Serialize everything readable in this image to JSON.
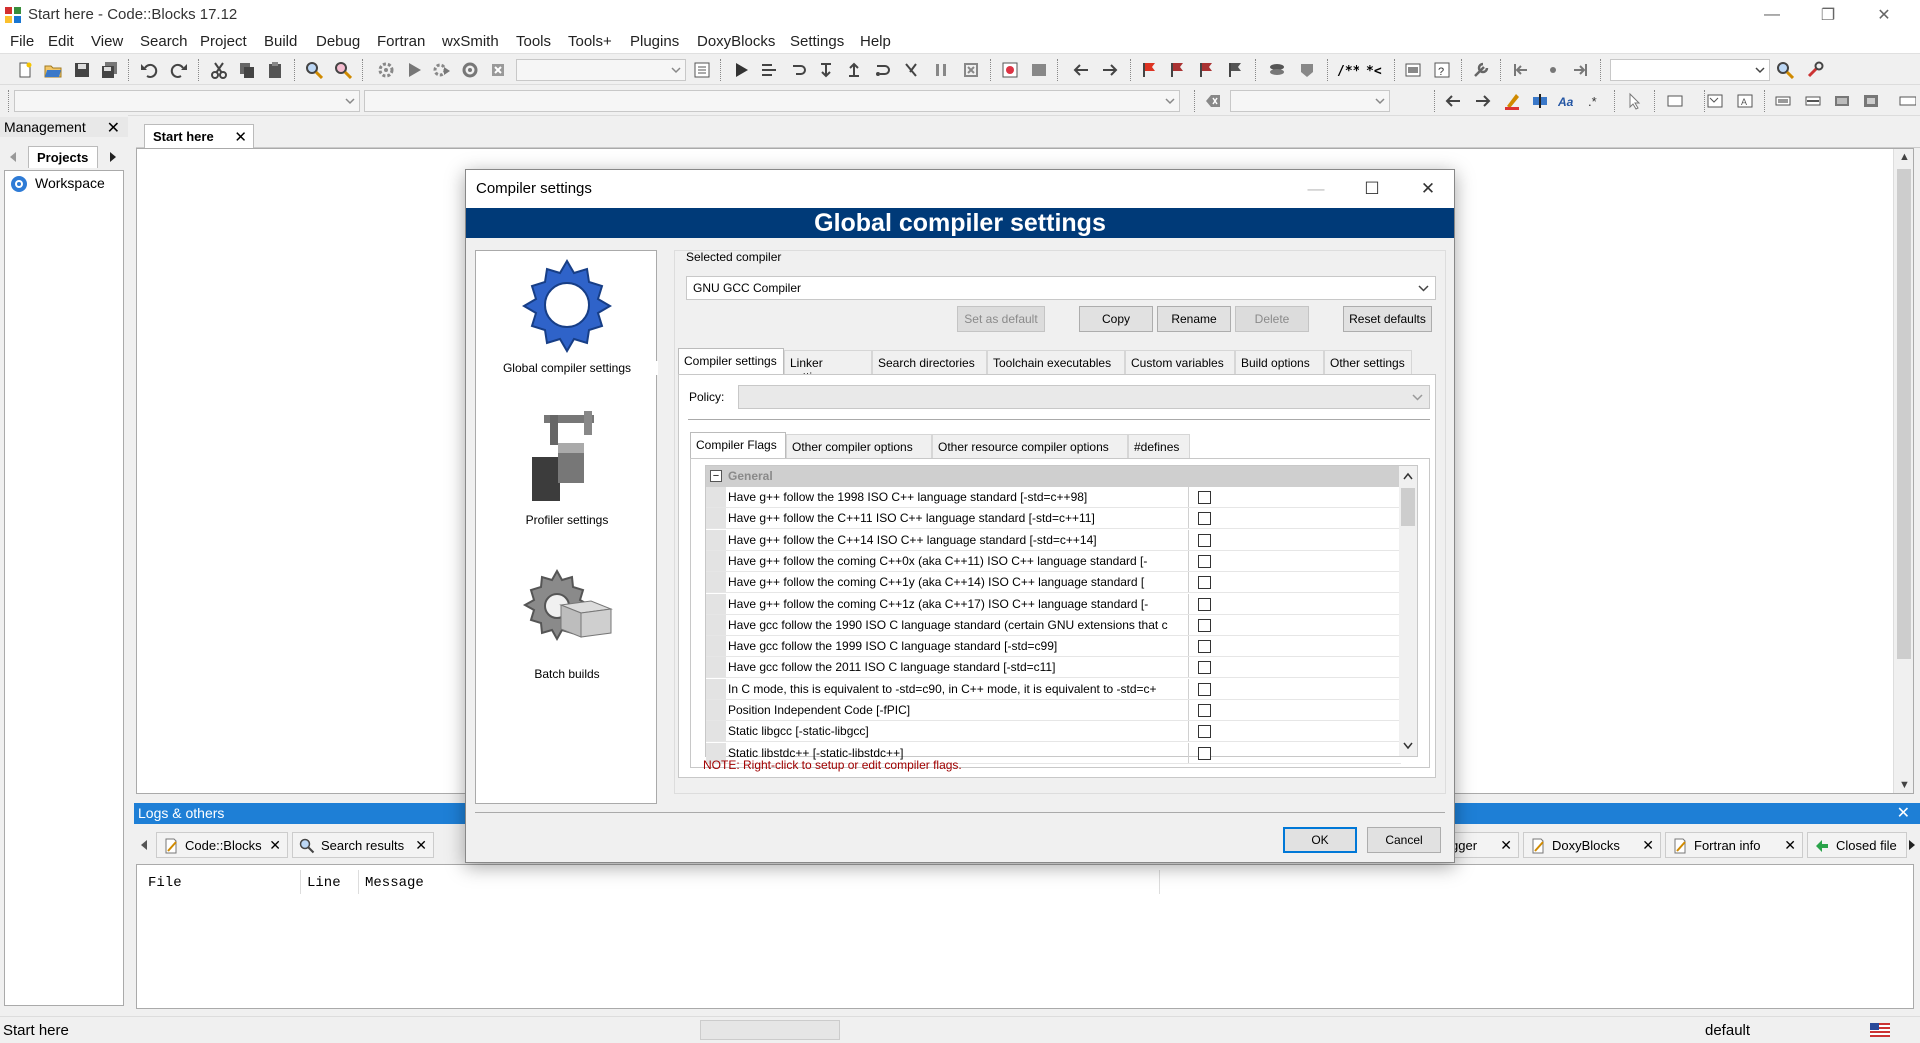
{
  "window": {
    "title": "Start here - Code::Blocks 17.12",
    "minimize": "—",
    "restore": "❐",
    "close": "✕"
  },
  "menu": [
    "File",
    "Edit",
    "View",
    "Search",
    "Project",
    "Build",
    "Debug",
    "Fortran",
    "wxSmith",
    "Tools",
    "Tools+",
    "Plugins",
    "DoxyBlocks",
    "Settings",
    "Help"
  ],
  "management": {
    "title": "Management",
    "close": "✕",
    "tab": "Projects",
    "workspace": "Workspace"
  },
  "editor": {
    "tab": "Start here",
    "tab_close": "✕"
  },
  "logs": {
    "title": "Logs & others",
    "close": "✕",
    "tabs_left": [
      {
        "label": "Code::Blocks",
        "icon": "doc-pencil-icon"
      },
      {
        "label": "Search results",
        "icon": "search-icon"
      }
    ],
    "tabs_right": [
      {
        "label": "gger",
        "icon": ""
      },
      {
        "label": "DoxyBlocks",
        "icon": "doc-pencil-icon"
      },
      {
        "label": "Fortran info",
        "icon": "doc-pencil-icon"
      },
      {
        "label": "Closed file",
        "icon": "closed-file-icon"
      }
    ],
    "columns": [
      "File",
      "Line",
      "Message"
    ]
  },
  "statusbar": {
    "left": "Start here",
    "right": "default"
  },
  "dialog": {
    "title": "Compiler settings",
    "banner": "Global compiler settings",
    "categories": [
      {
        "label": "Global compiler settings",
        "icon": "gear-icon"
      },
      {
        "label": "Profiler settings",
        "icon": "caliper-icon"
      },
      {
        "label": "Batch builds",
        "icon": "batch-gear-icon"
      }
    ],
    "selected_compiler_label": "Selected compiler",
    "selected_compiler": "GNU GCC Compiler",
    "buttons": {
      "set_default": "Set as default",
      "copy": "Copy",
      "rename": "Rename",
      "delete": "Delete",
      "reset": "Reset defaults"
    },
    "tabs": [
      "Compiler settings",
      "Linker settings",
      "Search directories",
      "Toolchain executables",
      "Custom variables",
      "Build options",
      "Other settings"
    ],
    "policy_label": "Policy:",
    "policy_value": "",
    "subtabs": [
      "Compiler Flags",
      "Other compiler options",
      "Other resource compiler options",
      "#defines"
    ],
    "flags_group": "General",
    "flags": [
      {
        "name": "Have g++ follow the 1998 ISO C++ language standard  [-std=c++98]",
        "checked": false
      },
      {
        "name": "Have g++ follow the C++11 ISO C++ language standard  [-std=c++11]",
        "checked": false
      },
      {
        "name": "Have g++ follow the C++14 ISO C++ language standard  [-std=c++14]",
        "checked": false
      },
      {
        "name": "Have g++ follow the coming C++0x (aka C++11) ISO C++ language standard  [-",
        "checked": false
      },
      {
        "name": "Have g++ follow the coming C++1y (aka C++14) ISO C++ language standard  [",
        "checked": false
      },
      {
        "name": "Have g++ follow the coming C++1z (aka C++17) ISO C++ language standard  [-",
        "checked": false
      },
      {
        "name": "Have gcc follow the 1990 ISO C language standard  (certain GNU extensions that c",
        "checked": false
      },
      {
        "name": "Have gcc follow the 1999 ISO C language standard  [-std=c99]",
        "checked": false
      },
      {
        "name": "Have gcc follow the 2011 ISO C language standard  [-std=c11]",
        "checked": false
      },
      {
        "name": "In C mode, this is equivalent to -std=c90, in C++ mode, it is equivalent to -std=c+",
        "checked": false
      },
      {
        "name": "Position Independent Code  [-fPIC]",
        "checked": false
      },
      {
        "name": "Static libgcc  [-static-libgcc]",
        "checked": false
      },
      {
        "name": "Static libstdc++  [-static-libstdc++]",
        "checked": false
      }
    ],
    "note": "NOTE: Right-click to setup or edit compiler flags.",
    "ok": "OK",
    "cancel": "Cancel"
  }
}
